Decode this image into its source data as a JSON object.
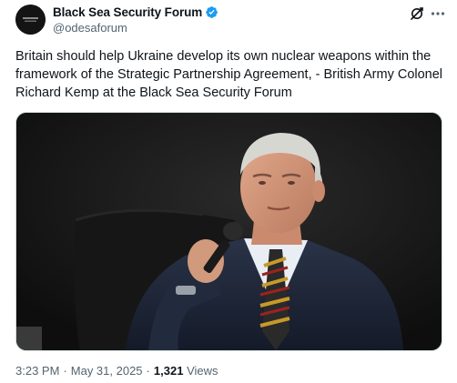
{
  "tweet": {
    "author": {
      "display_name": "Black Sea Security Forum",
      "handle": "@odesaforum",
      "verified": true,
      "verified_color": "#1d9bf0",
      "avatar_icon": "black-sea-security-forum-logo"
    },
    "text": "Britain should help Ukraine develop its own nuclear weapons within the framework of the Strategic Partnership Agreement, - British Army Colonel Richard Kemp at the Black Sea Security Forum",
    "media": {
      "type": "video-still"
    },
    "time": "3:23 PM",
    "separator": "·",
    "date": "May 31, 2025",
    "views_count": "1,321",
    "views_label": "Views"
  },
  "actions": {
    "grok_icon": "grok-icon",
    "more_icon": "more-icon"
  }
}
